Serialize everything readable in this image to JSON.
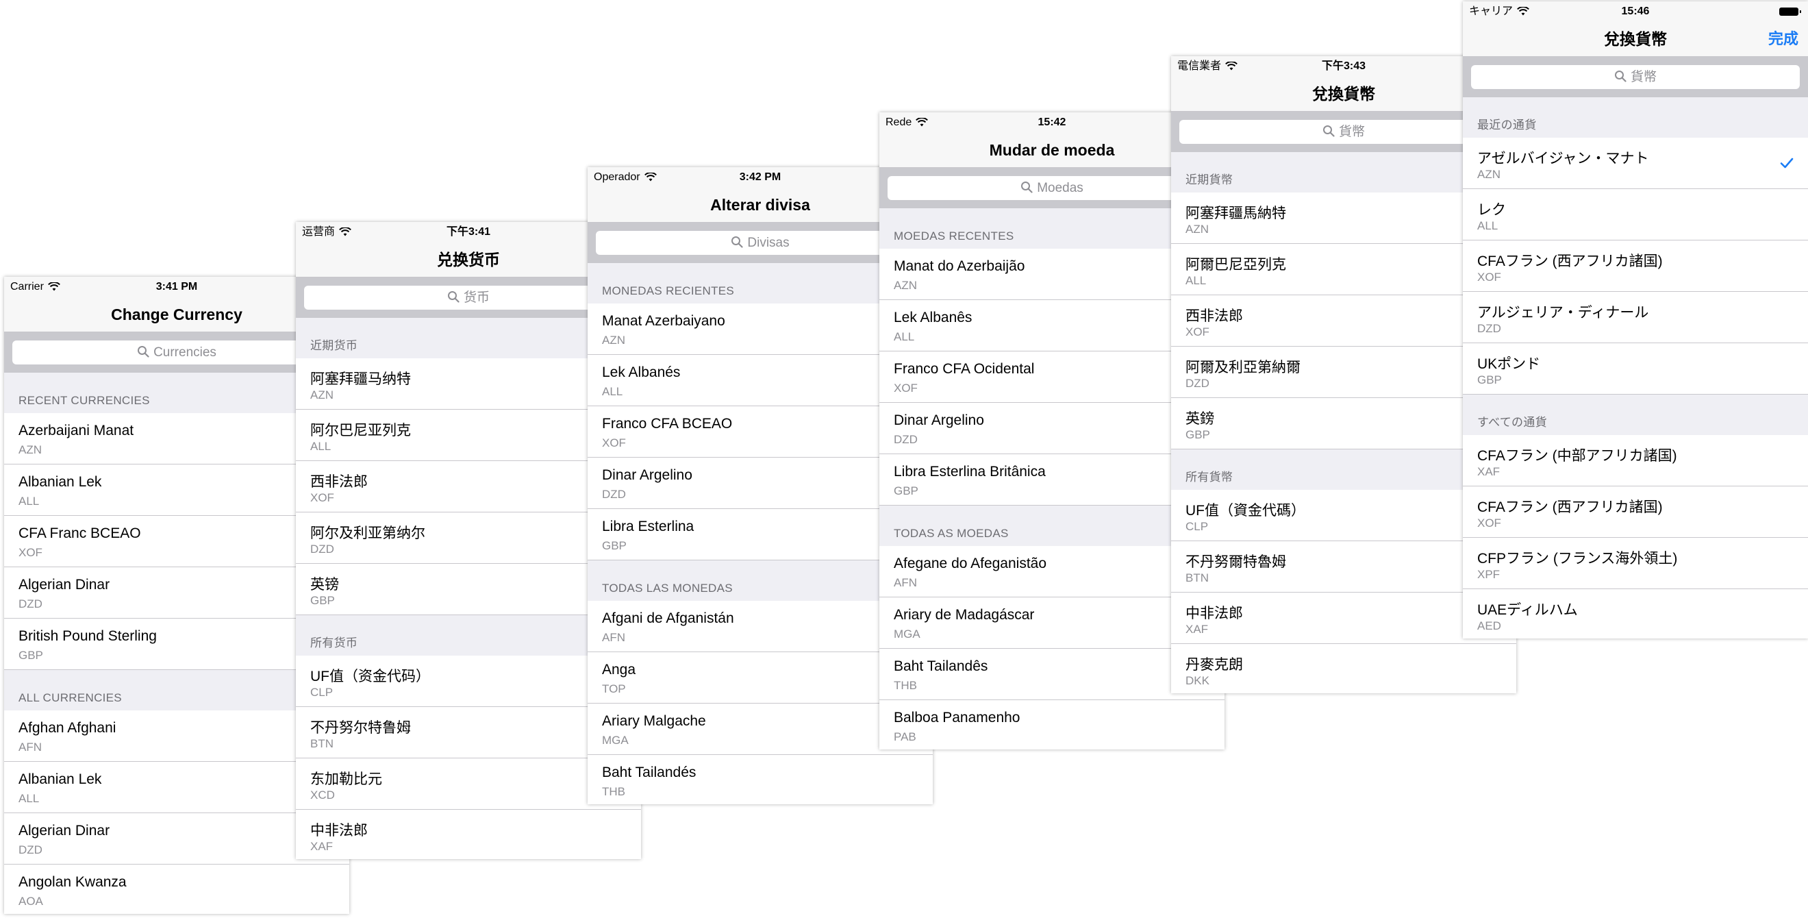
{
  "colors": {
    "accent": "#1a7cf5",
    "navbar": "#f7f7f7",
    "background": "#efeff4",
    "search_bar": "#c9c9ce"
  },
  "screens": [
    {
      "carrier": "Carrier",
      "time": "3:41 PM",
      "title": "Change Currency",
      "done": "",
      "search_placeholder": "Currencies",
      "recent_header": "RECENT CURRENCIES",
      "recent": [
        {
          "name": "Azerbaijani Manat",
          "code": "AZN"
        },
        {
          "name": "Albanian Lek",
          "code": "ALL"
        },
        {
          "name": "CFA Franc BCEAO",
          "code": "XOF"
        },
        {
          "name": "Algerian Dinar",
          "code": "DZD"
        },
        {
          "name": "British Pound Sterling",
          "code": "GBP"
        }
      ],
      "all_header": "ALL CURRENCIES",
      "all": [
        {
          "name": "Afghan Afghani",
          "code": "AFN"
        },
        {
          "name": "Albanian Lek",
          "code": "ALL"
        },
        {
          "name": "Algerian Dinar",
          "code": "DZD"
        },
        {
          "name": "Angolan Kwanza",
          "code": "AOA"
        }
      ]
    },
    {
      "carrier": "运营商",
      "time": "下午3:41",
      "title": "兑换货币",
      "done": "",
      "search_placeholder": "货币",
      "recent_header": "近期货币",
      "recent": [
        {
          "name": "阿塞拜疆马纳特",
          "code": "AZN"
        },
        {
          "name": "阿尔巴尼亚列克",
          "code": "ALL"
        },
        {
          "name": "西非法郎",
          "code": "XOF"
        },
        {
          "name": "阿尔及利亚第纳尔",
          "code": "DZD"
        },
        {
          "name": "英镑",
          "code": "GBP"
        }
      ],
      "all_header": "所有货币",
      "all": [
        {
          "name": "UF值（资金代码）",
          "code": "CLP"
        },
        {
          "name": "不丹努尔特鲁姆",
          "code": "BTN"
        },
        {
          "name": "东加勒比元",
          "code": "XCD"
        },
        {
          "name": "中非法郎",
          "code": "XAF"
        }
      ]
    },
    {
      "carrier": "Operador",
      "time": "3:42 PM",
      "title": "Alterar divisa",
      "done": "",
      "search_placeholder": "Divisas",
      "recent_header": "MONEDAS RECIENTES",
      "recent": [
        {
          "name": "Manat Azerbaiyano",
          "code": "AZN"
        },
        {
          "name": "Lek Albanés",
          "code": "ALL"
        },
        {
          "name": "Franco CFA BCEAO",
          "code": "XOF"
        },
        {
          "name": "Dinar Argelino",
          "code": "DZD"
        },
        {
          "name": "Libra Esterlina",
          "code": "GBP"
        }
      ],
      "all_header": "TODAS LAS MONEDAS",
      "all": [
        {
          "name": "Afgani de Afganistán",
          "code": "AFN"
        },
        {
          "name": "Anga",
          "code": "TOP"
        },
        {
          "name": "Ariary Malgache",
          "code": "MGA"
        },
        {
          "name": "Baht Tailandés",
          "code": "THB"
        }
      ]
    },
    {
      "carrier": "Rede",
      "time": "15:42",
      "title": "Mudar de moeda",
      "done": "",
      "search_placeholder": "Moedas",
      "recent_header": "MOEDAS RECENTES",
      "recent": [
        {
          "name": "Manat do Azerbaijão",
          "code": "AZN"
        },
        {
          "name": "Lek Albanês",
          "code": "ALL"
        },
        {
          "name": "Franco CFA Ocidental",
          "code": "XOF"
        },
        {
          "name": "Dinar Argelino",
          "code": "DZD"
        },
        {
          "name": "Libra Esterlina Britânica",
          "code": "GBP"
        }
      ],
      "all_header": "TODAS AS MOEDAS",
      "all": [
        {
          "name": "Afegane do Afeganistão",
          "code": "AFN"
        },
        {
          "name": "Ariary de Madagáscar",
          "code": "MGA"
        },
        {
          "name": "Baht Tailandês",
          "code": "THB"
        },
        {
          "name": "Balboa Panamenho",
          "code": "PAB"
        }
      ]
    },
    {
      "carrier": "電信業者",
      "time": "下午3:43",
      "title": "兌換貨幣",
      "done": "",
      "search_placeholder": "貨幣",
      "recent_header": "近期貨幣",
      "recent": [
        {
          "name": "阿塞拜疆馬納特",
          "code": "AZN"
        },
        {
          "name": "阿爾巴尼亞列克",
          "code": "ALL"
        },
        {
          "name": "西非法郎",
          "code": "XOF"
        },
        {
          "name": "阿爾及利亞第納爾",
          "code": "DZD"
        },
        {
          "name": "英鎊",
          "code": "GBP"
        }
      ],
      "all_header": "所有貨幣",
      "all": [
        {
          "name": "UF值（資金代碼）",
          "code": "CLP"
        },
        {
          "name": "不丹努爾特魯姆",
          "code": "BTN"
        },
        {
          "name": "中非法郎",
          "code": "XAF"
        },
        {
          "name": "丹麥克朗",
          "code": "DKK"
        }
      ]
    },
    {
      "carrier": "キャリア",
      "time": "15:46",
      "title": "兌換貨幣",
      "done": "完成",
      "search_placeholder": "貨幣",
      "recent_header": "最近の通貨",
      "recent": [
        {
          "name": "アゼルバイジャン・マナト",
          "code": "AZN",
          "checked": true
        },
        {
          "name": "レク",
          "code": "ALL"
        },
        {
          "name": "CFAフラン (西アフリカ諸国)",
          "code": "XOF"
        },
        {
          "name": "アルジェリア・ディナール",
          "code": "DZD"
        },
        {
          "name": "UKポンド",
          "code": "GBP"
        }
      ],
      "all_header": "すべての通貨",
      "all": [
        {
          "name": "CFAフラン (中部アフリカ諸国)",
          "code": "XAF"
        },
        {
          "name": "CFAフラン (西アフリカ諸国)",
          "code": "XOF"
        },
        {
          "name": "CFPフラン (フランス海外領土)",
          "code": "XPF"
        },
        {
          "name": "UAEディルハム",
          "code": "AED"
        }
      ]
    }
  ]
}
